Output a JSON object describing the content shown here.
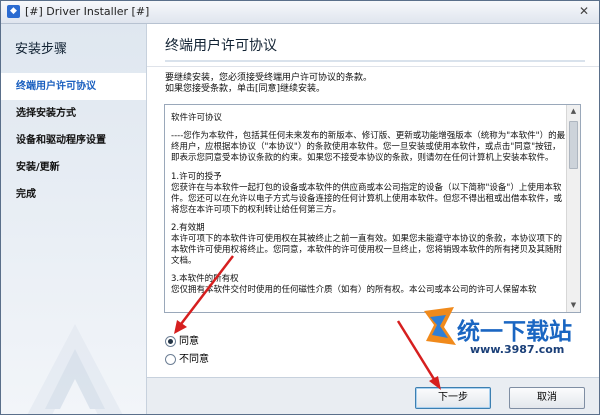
{
  "window": {
    "title": "[#] Driver Installer [#]",
    "close_glyph": "✕"
  },
  "sidebar": {
    "title": "安装步骤",
    "steps": [
      {
        "label": "终端用户许可协议",
        "active": true
      },
      {
        "label": "选择安装方式"
      },
      {
        "label": "设备和驱动程序设置"
      },
      {
        "label": "安装/更新"
      },
      {
        "label": "完成"
      }
    ]
  },
  "header": {
    "title": "终端用户许可协议"
  },
  "intro": {
    "line1": "要继续安装，您必须接受终端用户许可协议的条款。",
    "line2": "如果您接受条款，单击[同意]继续安装。"
  },
  "license": {
    "heading": "软件许可协议",
    "p1": "----您作为本软件，包括其任何未来发布的新版本、修订版、更新或功能增强版本（统称为\"本软件\"）的最终用户，应根据本协议（\"本协议\"）的条款使用本软件。您一旦安装或使用本软件，或点击\"同意\"按钮，即表示您同意受本协议条款的约束。如果您不接受本协议的条款，则请勿在任何计算机上安装本软件。",
    "s1_title": "1.许可的授予",
    "s1_body": "您获许在与本软件一起打包的设备或本软件的供应商或本公司指定的设备（以下简称\"设备\"）上使用本软件。您还可以在允许以电子方式与设备连接的任何计算机上使用本软件。但您不得出租或出借本软件，或将您在本许可项下的权利转让给任何第三方。",
    "s2_title": "2.有效期",
    "s2_body": "本许可项下的本软件许可使用权在其被终止之前一直有效。如果您未能遵守本协议的条款，本协议项下的本软件许可使用权将终止。您同意，本软件的许可使用权一旦终止，您将销毁本软件的所有拷贝及其随附文档。",
    "s3_title": "3.本软件的所有权",
    "s3_body": "您仅拥有本软件交付时使用的任何磁性介质（如有）的所有权。本公司或本公司的许可人保留本软"
  },
  "options": {
    "agree": "同意",
    "disagree": "不同意",
    "selected": "agree"
  },
  "buttons": {
    "next": "下一步",
    "cancel": "取消"
  },
  "watermark": {
    "brand": "统一下载站",
    "url": "www.3987.com"
  },
  "colors": {
    "accent": "#1a5fbf",
    "annotation": "#d61f1f"
  }
}
